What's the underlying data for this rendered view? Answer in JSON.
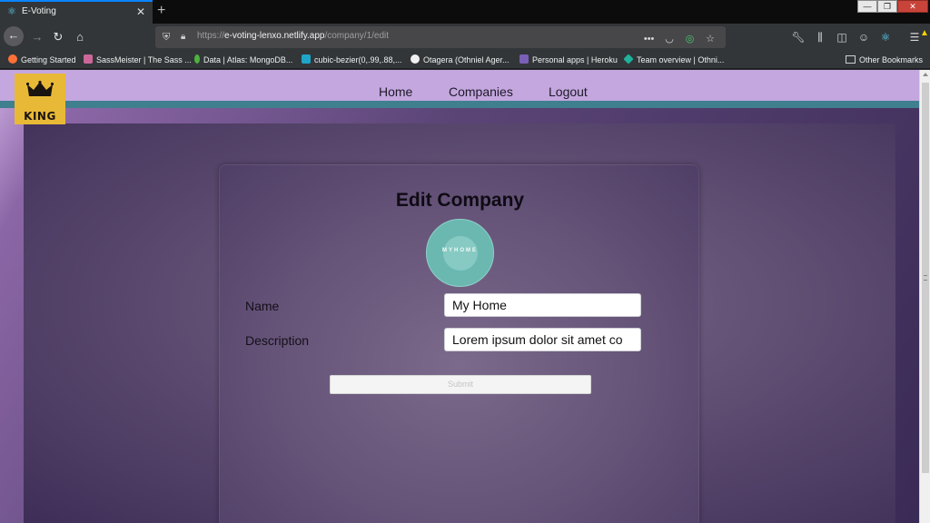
{
  "browser": {
    "tab": {
      "title": "E-Voting",
      "icon": "react-icon"
    },
    "url": {
      "scheme": "https://",
      "host": "e-voting-lenxo.netlify.app",
      "path": "/company/1/edit"
    },
    "bookmarks": [
      {
        "label": "Getting Started",
        "icon": "firefox-icon",
        "color": "#ff7139"
      },
      {
        "label": "SassMeister | The Sass ...",
        "icon": "sassmeister-icon",
        "color": "#cd6799"
      },
      {
        "label": "Data | Atlas: MongoDB...",
        "icon": "mongodb-leaf-icon",
        "color": "#4db33d"
      },
      {
        "label": "cubic-bezier(0,.99,.88,...",
        "icon": "cubic-bezier-icon",
        "color": "#1fa5ca"
      },
      {
        "label": "Otagera (Othniel Ager...",
        "icon": "github-icon",
        "color": "#f0f0f0"
      },
      {
        "label": "Personal apps | Heroku",
        "icon": "heroku-icon",
        "color": "#7b5fb6"
      },
      {
        "label": "Team overview | Othni...",
        "icon": "diamond-icon",
        "color": "#20b29b"
      }
    ],
    "other_bookmarks": "Other Bookmarks"
  },
  "site": {
    "logo_text": "KING",
    "nav": {
      "home": "Home",
      "companies": "Companies",
      "logout": "Logout"
    }
  },
  "form": {
    "title": "Edit Company",
    "company_logo_text": "MYHOME",
    "name_label": "Name",
    "name_value": "My Home",
    "description_label": "Description",
    "description_value": "Lorem ipsum dolor sit amet co",
    "submit_label": "Submit"
  },
  "colors": {
    "header_bg": "#c4a7de",
    "header_stripe": "#3f7f8e",
    "logo_bg": "#e8b936",
    "company_logo_bg": "#6bb8b1"
  }
}
